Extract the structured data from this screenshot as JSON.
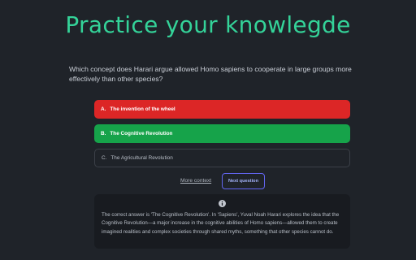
{
  "page": {
    "title": "Practice your knowlegde"
  },
  "question": {
    "text": "Which concept does Harari argue allowed Homo sapiens to cooperate in large groups more effectively than other species?"
  },
  "options": [
    {
      "letter": "A.",
      "label": "The invention of the wheel",
      "state": "incorrect"
    },
    {
      "letter": "B.",
      "label": "The Cognitive Revolution",
      "state": "correct"
    },
    {
      "letter": "C.",
      "label": "The Agricultural Revolution",
      "state": "neutral"
    }
  ],
  "actions": {
    "more_context": "More context",
    "next_question": "Next question"
  },
  "context": {
    "icon": "info-icon",
    "text": "The correct answer is 'The Cognitive Revolution'. In 'Sapiens', Yuval Noah Harari explores the idea that the Cognitive Revolution—a major increase in the cognitive abilities of Homo sapiens—allowed them to create imagined realities and complex societies through shared myths, something that other species cannot do."
  },
  "colors": {
    "background": "#1f2329",
    "title": "#34d399",
    "incorrect": "#dc2626",
    "correct": "#16a34a",
    "accent": "#6366f1"
  }
}
